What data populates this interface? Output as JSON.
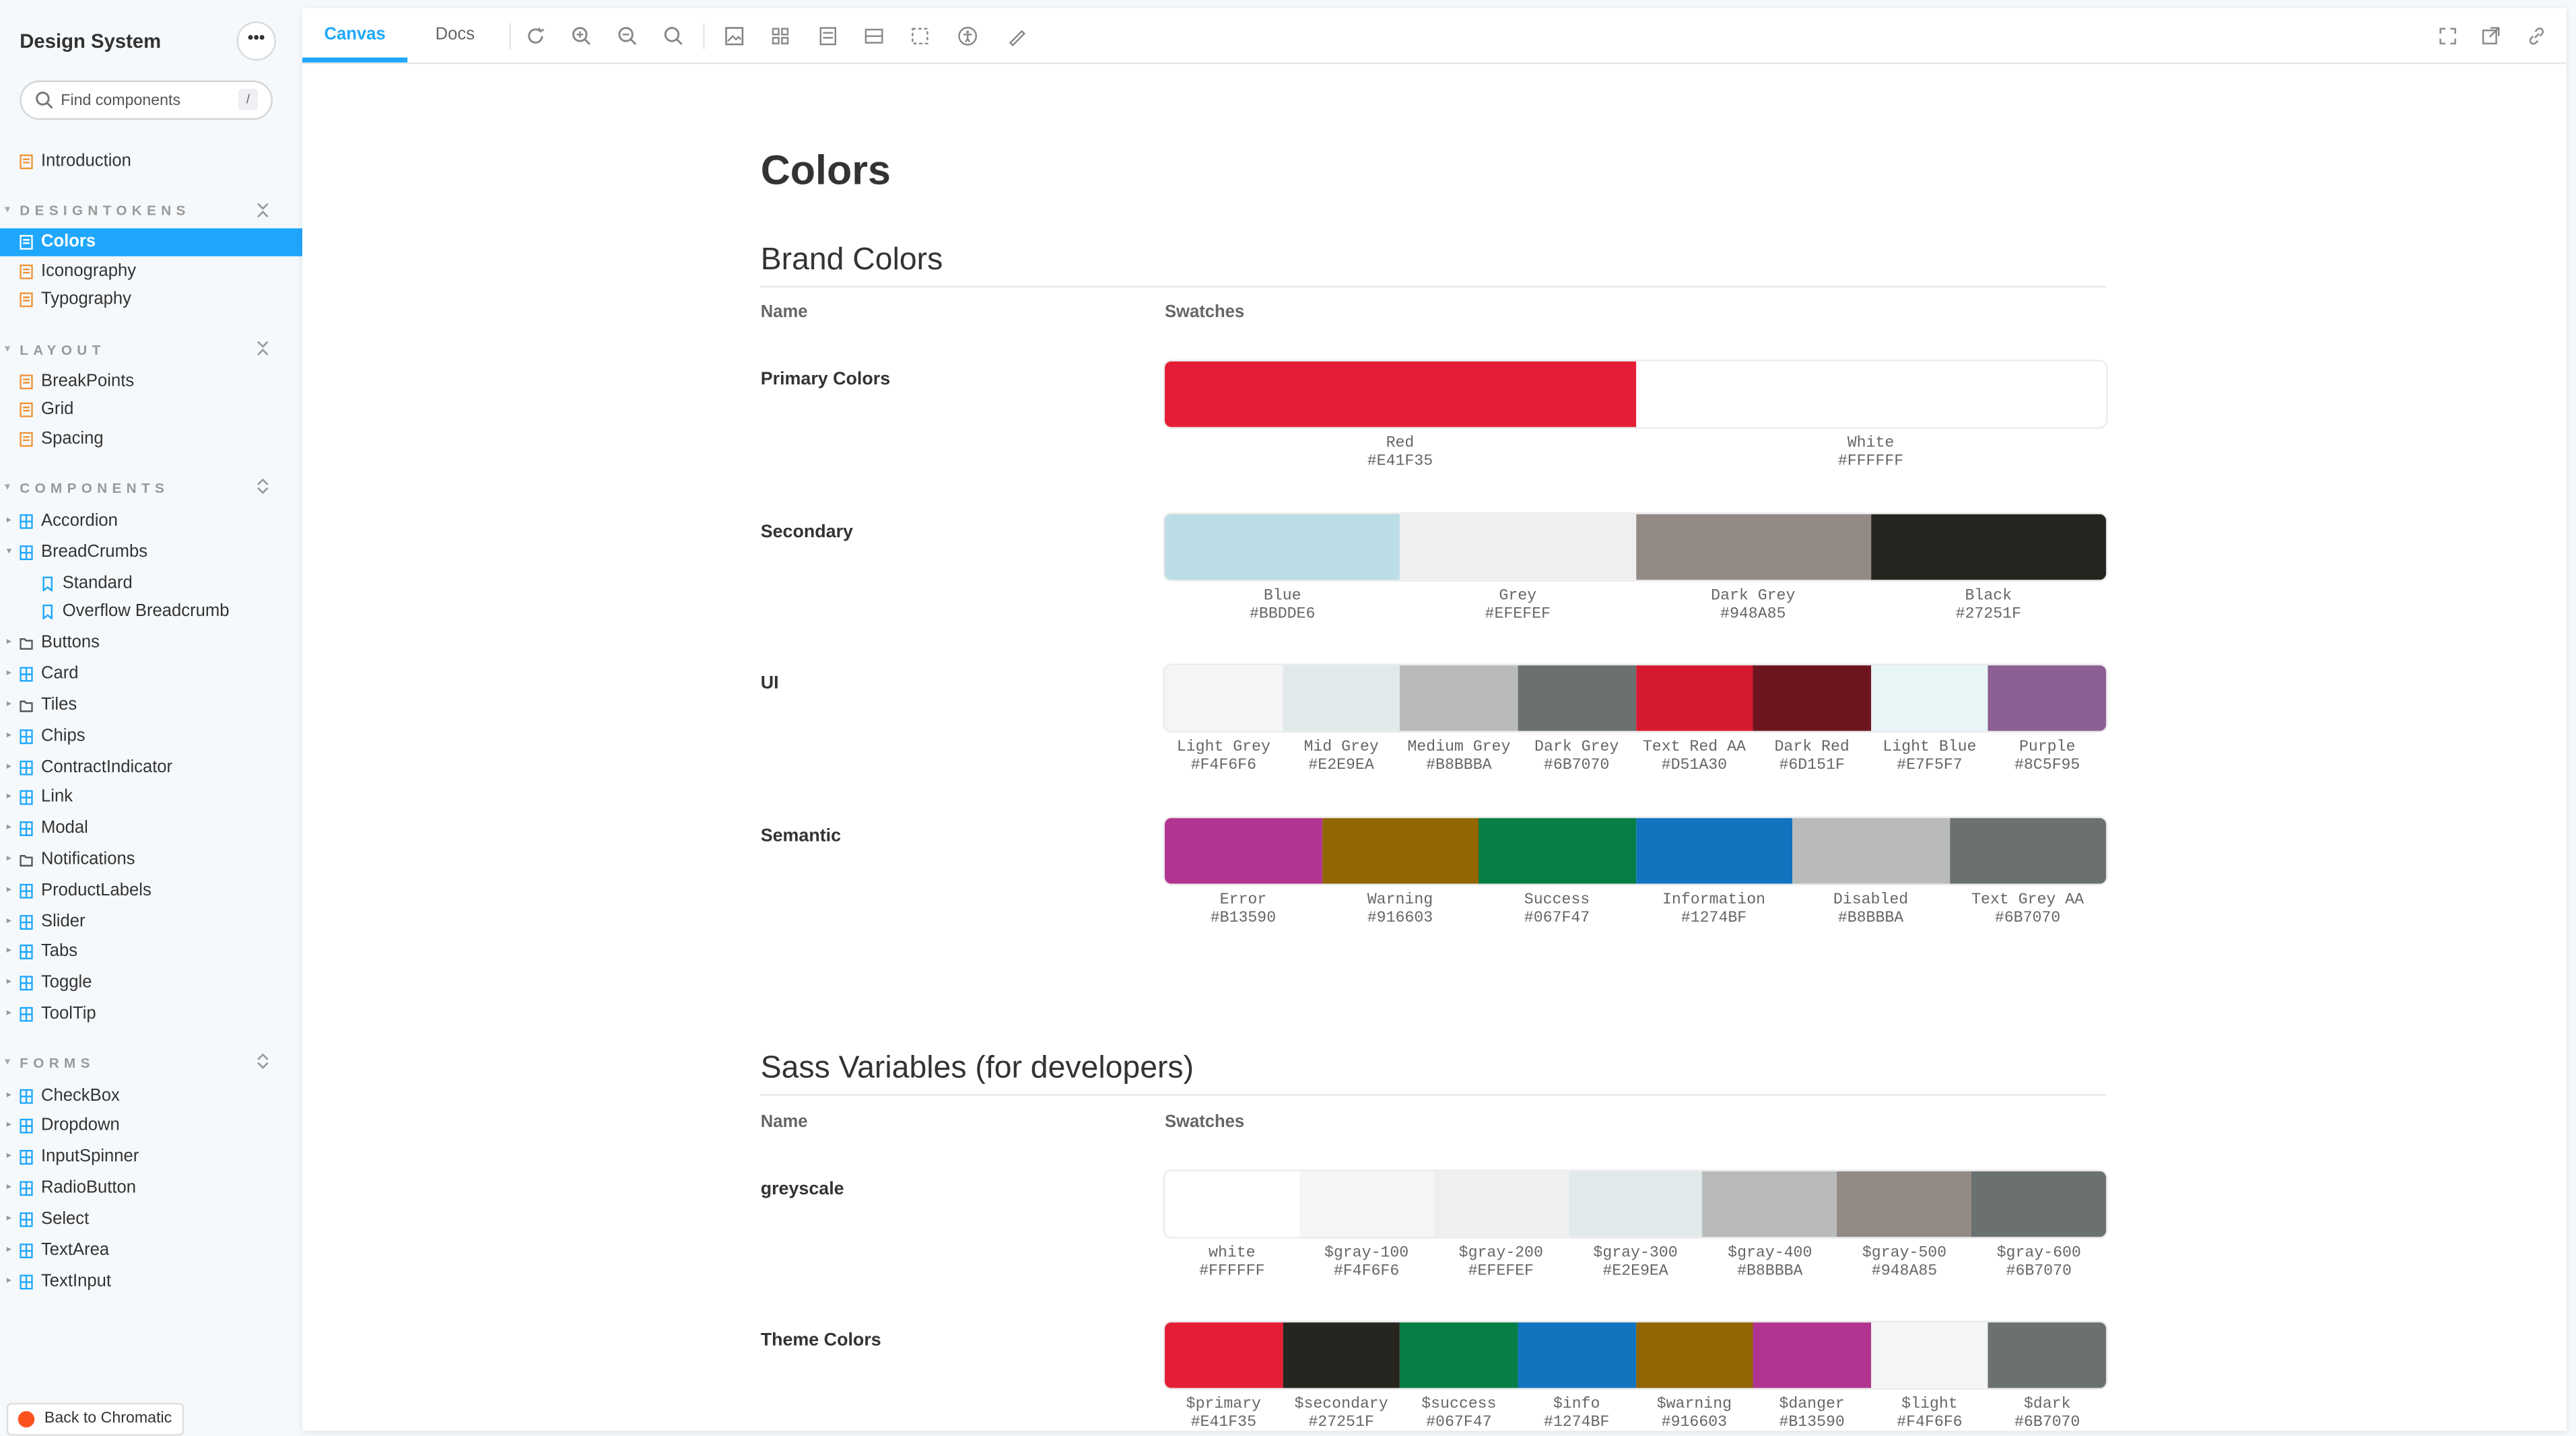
{
  "sidebar": {
    "title": "Design System",
    "menu_label": "•••",
    "search_placeholder": "Find components",
    "search_shortcut": "/",
    "intro": "Introduction",
    "sections": {
      "designtokens": "DESIGNTOKENS",
      "layout": "LAYOUT",
      "components": "COMPONENTS",
      "forms": "FORMS"
    },
    "designtokens_items": [
      "Colors",
      "Iconography",
      "Typography"
    ],
    "layout_items": [
      "BreakPoints",
      "Grid",
      "Spacing"
    ],
    "components_items": [
      "Accordion",
      "BreadCrumbs",
      "Standard",
      "Overflow Breadcrumb",
      "Buttons",
      "Card",
      "Tiles",
      "Chips",
      "ContractIndicator",
      "Link",
      "Modal",
      "Notifications",
      "ProductLabels",
      "Slider",
      "Tabs",
      "Toggle",
      "ToolTip"
    ],
    "forms_items": [
      "CheckBox",
      "Dropdown",
      "InputSpinner",
      "RadioButton",
      "Select",
      "TextArea",
      "TextInput"
    ],
    "back_label": "Back to Chromatic"
  },
  "toolbar": {
    "tab_canvas": "Canvas",
    "tab_docs": "Docs"
  },
  "doc": {
    "title": "Colors",
    "brand_heading": "Brand Colors",
    "sass_heading": "Sass Variables (for developers)",
    "col_name": "Name",
    "col_swatches": "Swatches",
    "rows": {
      "primary": {
        "name": "Primary Colors",
        "swatches": [
          {
            "label": "Red",
            "hex": "#E41F35"
          },
          {
            "label": "White",
            "hex": "#FFFFFF"
          }
        ]
      },
      "secondary": {
        "name": "Secondary",
        "swatches": [
          {
            "label": "Blue",
            "hex": "#BBDDE6"
          },
          {
            "label": "Grey",
            "hex": "#EFEFEF"
          },
          {
            "label": "Dark Grey",
            "hex": "#948A85"
          },
          {
            "label": "Black",
            "hex": "#27251F"
          }
        ]
      },
      "ui": {
        "name": "UI",
        "swatches": [
          {
            "label": "Light Grey",
            "hex": "#F4F6F6"
          },
          {
            "label": "Mid Grey",
            "hex": "#E2E9EA"
          },
          {
            "label": "Medium Grey",
            "hex": "#B8BBBA"
          },
          {
            "label": "Dark Grey",
            "hex": "#6B7070"
          },
          {
            "label": "Text Red AA",
            "hex": "#D51A30"
          },
          {
            "label": "Dark Red",
            "hex": "#6D151F"
          },
          {
            "label": "Light Blue",
            "hex": "#E7F5F7"
          },
          {
            "label": "Purple",
            "hex": "#8C5F95"
          }
        ]
      },
      "semantic": {
        "name": "Semantic",
        "swatches": [
          {
            "label": "Error",
            "hex": "#B13590"
          },
          {
            "label": "Warning",
            "hex": "#916603"
          },
          {
            "label": "Success",
            "hex": "#067F47"
          },
          {
            "label": "Information",
            "hex": "#1274BF"
          },
          {
            "label": "Disabled",
            "hex": "#B8BBBA"
          },
          {
            "label": "Text Grey AA",
            "hex": "#6B7070"
          }
        ]
      },
      "greyscale": {
        "name": "greyscale",
        "swatches": [
          {
            "label": "white",
            "hex": "#FFFFFF"
          },
          {
            "label": "$gray-100",
            "hex": "#F4F6F6"
          },
          {
            "label": "$gray-200",
            "hex": "#EFEFEF"
          },
          {
            "label": "$gray-300",
            "hex": "#E2E9EA"
          },
          {
            "label": "$gray-400",
            "hex": "#B8BBBA"
          },
          {
            "label": "$gray-500",
            "hex": "#948A85"
          },
          {
            "label": "$gray-600",
            "hex": "#6B7070"
          }
        ]
      },
      "theme": {
        "name": "Theme Colors",
        "swatches": [
          {
            "label": "$primary",
            "hex": "#E41F35"
          },
          {
            "label": "$secondary",
            "hex": "#27251F"
          },
          {
            "label": "$success",
            "hex": "#067F47"
          },
          {
            "label": "$info",
            "hex": "#1274BF"
          },
          {
            "label": "$warning",
            "hex": "#916603"
          },
          {
            "label": "$danger",
            "hex": "#B13590"
          },
          {
            "label": "$light",
            "hex": "#F4F6F6"
          },
          {
            "label": "$dark",
            "hex": "#6B7070"
          }
        ]
      }
    }
  },
  "colors": {
    "accent": "#1ea7fd",
    "doc_icon": "#f09235",
    "component_icon": "#1ea7fd"
  }
}
